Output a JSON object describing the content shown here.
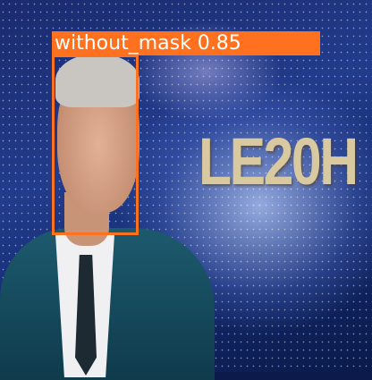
{
  "background_text": "LE20H",
  "detection": {
    "class_label": "without_mask",
    "score": "0.85",
    "label_text": "without_mask 0.85",
    "color": "#ff701f"
  }
}
